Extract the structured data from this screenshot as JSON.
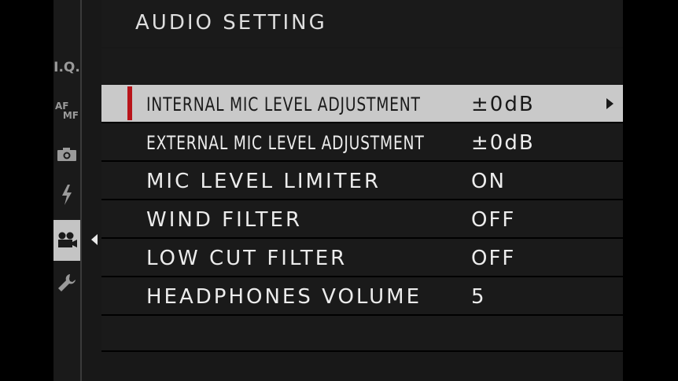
{
  "header": {
    "title": "AUDIO SETTING"
  },
  "sidebar": {
    "tabs": [
      {
        "id": "iq",
        "label": "I.Q.",
        "icon": "image-quality-icon"
      },
      {
        "id": "afmf",
        "label_top": "AF",
        "label_bottom": "MF",
        "icon": "focus-mode-icon"
      },
      {
        "id": "shooting",
        "icon": "camera-icon"
      },
      {
        "id": "flash",
        "icon": "flash-icon"
      },
      {
        "id": "movie",
        "icon": "movie-camera-icon",
        "active": true
      },
      {
        "id": "setup",
        "icon": "wrench-icon"
      }
    ]
  },
  "menu": {
    "items": [
      {
        "label": "INTERNAL MIC LEVEL ADJUSTMENT",
        "value": "±0dB",
        "selected": true,
        "condensed": true
      },
      {
        "label": "EXTERNAL MIC LEVEL ADJUSTMENT",
        "value": "±0dB",
        "condensed": true
      },
      {
        "label": "MIC LEVEL LIMITER",
        "value": "ON"
      },
      {
        "label": "WIND FILTER",
        "value": "OFF"
      },
      {
        "label": "LOW CUT FILTER",
        "value": "OFF"
      },
      {
        "label": "HEADPHONES VOLUME",
        "value": "5"
      }
    ]
  },
  "colors": {
    "selection_marker": "#b8141a",
    "selected_row": "#c9c9c9",
    "panel": "#1a1a1a"
  }
}
